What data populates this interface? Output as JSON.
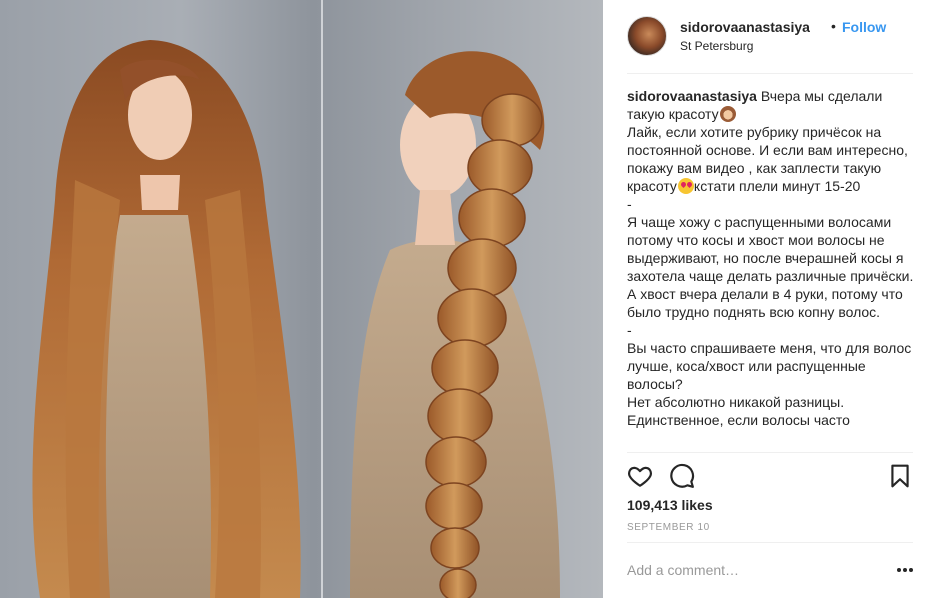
{
  "post": {
    "username": "sidorovaanastasiya",
    "separator": "•",
    "follow_label": "Follow",
    "location": "St Petersburg",
    "caption": {
      "author": "sidorovaanastasiya",
      "line1": "Вчера мы сделали такую красоту",
      "line2": "Лайк, если хотите рубрику причёсок на постоянной основе. И если вам интересно, покажу вам видео , как заплести такую красоту",
      "line2_after": "кстати плели минут 15-20",
      "dash1": "-",
      "line3": "Я чаще хожу с распущенными волосами потому что косы и хвост мои волосы не выдерживают, но после вчерашней косы я захотела чаще делать различные причёски. А хвост вчера делали в 4 руки, потому что было трудно поднять всю копну волос.",
      "dash2": "-",
      "line4": "Вы часто спрашиваете меня, что для волос лучше, коса/хвост или распущенные волосы?",
      "line5": "Нет абсолютно никакой разницы. Единственное, если волосы часто"
    },
    "likes": "109,413 likes",
    "date": "SEPTEMBER 10",
    "comment_placeholder": "Add a comment…"
  },
  "icons": {
    "like": "heart-icon",
    "comment": "comment-icon",
    "save": "bookmark-icon",
    "more": "more-options-icon",
    "emoji1": "see-no-evil-monkey-emoji",
    "emoji2": "heart-eyes-emoji"
  },
  "colors": {
    "follow": "#3897f0",
    "text": "#262626",
    "muted": "#999999",
    "divider": "#efefef"
  }
}
